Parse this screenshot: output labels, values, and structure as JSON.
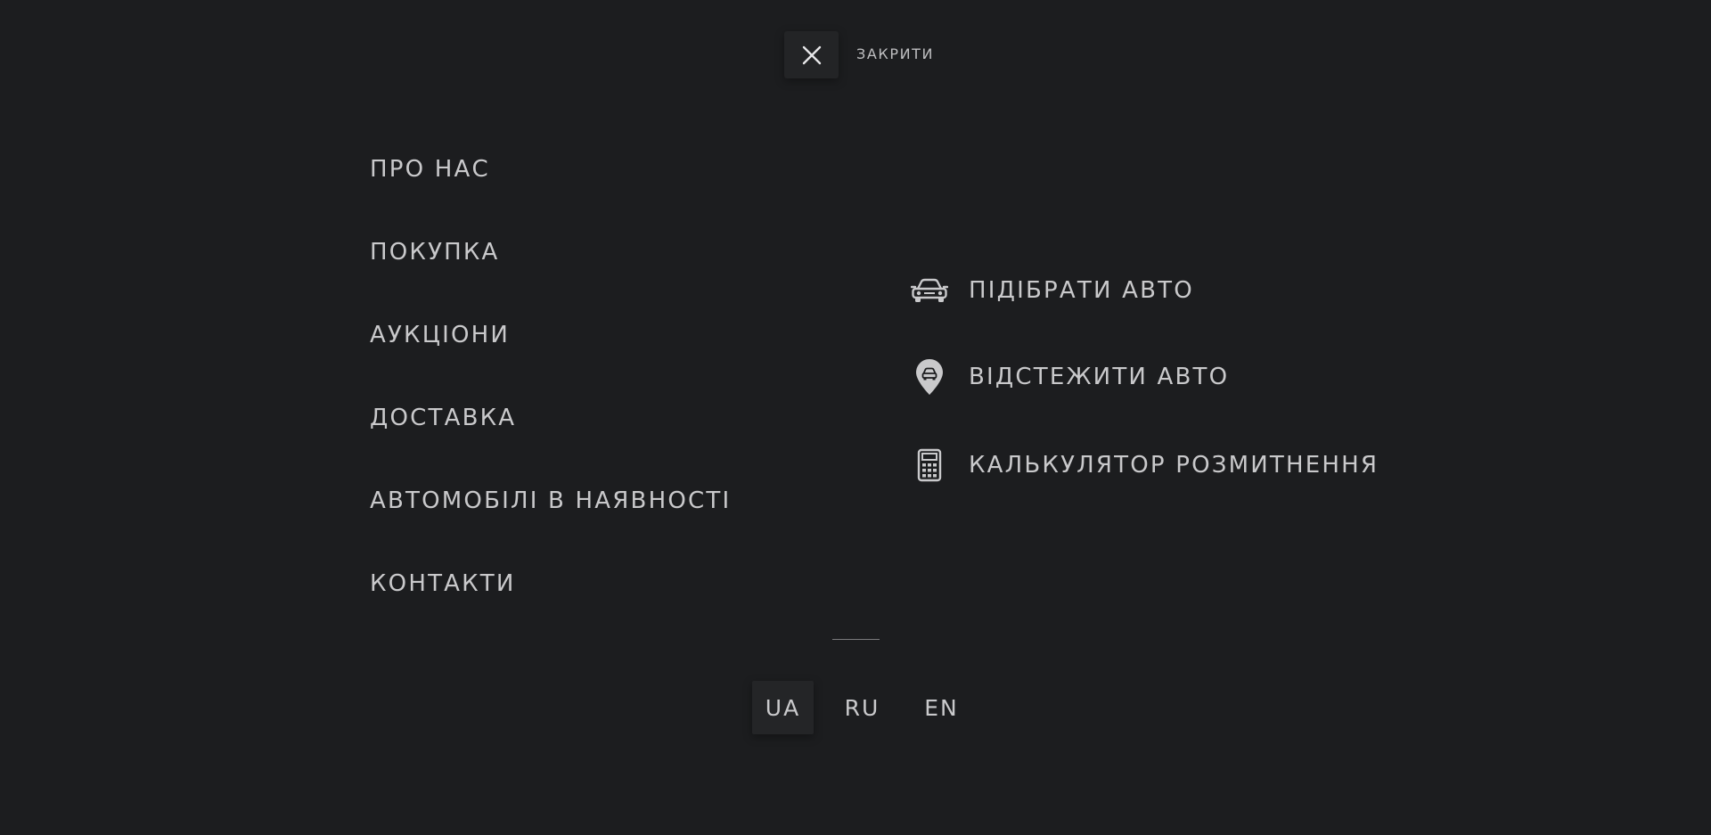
{
  "close": {
    "label": "ЗАКРИТИ",
    "icon": "close-icon"
  },
  "menu": {
    "items": [
      {
        "label": "ПРО НАС"
      },
      {
        "label": "ПОКУПКА"
      },
      {
        "label": "АУКЦІОНИ"
      },
      {
        "label": "ДОСТАВКА"
      },
      {
        "label": "АВТОМОБІЛІ В НАЯВНОСТІ"
      },
      {
        "label": "КОНТАКТИ"
      }
    ]
  },
  "actions": {
    "items": [
      {
        "label": "ПІДІБРАТИ АВТО",
        "icon": "car-icon"
      },
      {
        "label": "ВІДСТЕЖИТИ АВТО",
        "icon": "map-pin-car-icon"
      },
      {
        "label": "КАЛЬКУЛЯТОР РОЗМИТНЕННЯ",
        "icon": "calculator-icon"
      }
    ]
  },
  "languages": {
    "items": [
      {
        "label": "UA",
        "active": true
      },
      {
        "label": "RU",
        "active": false
      },
      {
        "label": "EN",
        "active": false
      }
    ]
  },
  "colors": {
    "background": "#1c1d1f",
    "text": "#c9c9cb",
    "button": "#232426"
  }
}
